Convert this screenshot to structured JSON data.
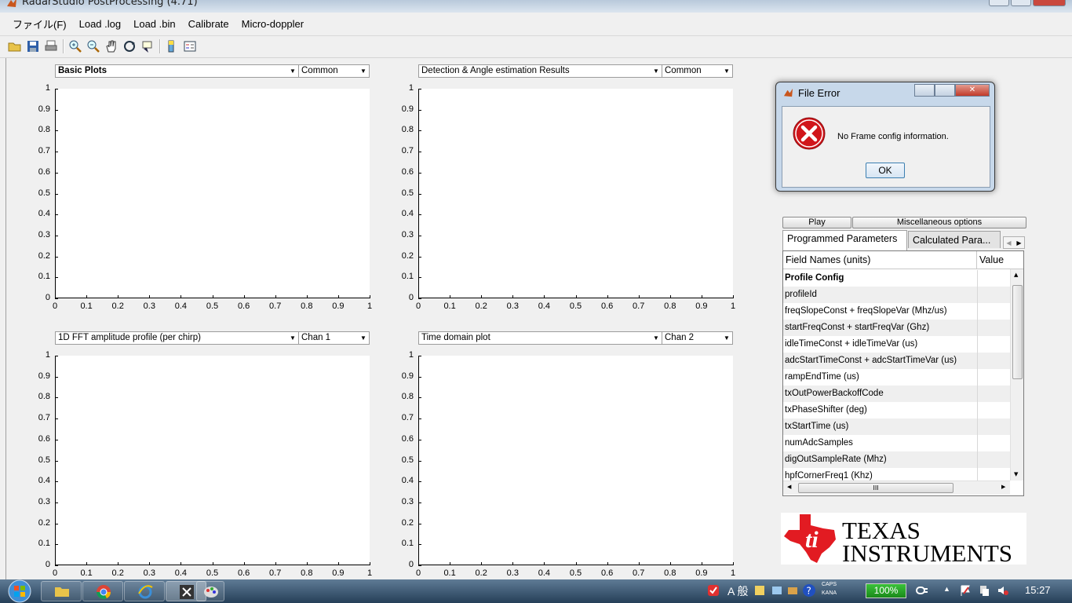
{
  "window": {
    "title": "RadarStudio PostProcessing (4.71)"
  },
  "menu": [
    "ファイル(F)",
    "Load .log",
    "Load .bin",
    "Calibrate",
    "Micro-doppler"
  ],
  "toolbar": {
    "icons": [
      "open-folder-icon",
      "save-icon",
      "print-icon",
      "zoom-in-icon",
      "zoom-out-icon",
      "pan-hand-icon",
      "rotate-3d-icon",
      "data-cursor-icon",
      "colorbar-icon",
      "legend-icon"
    ]
  },
  "plots": [
    {
      "select": "Basic Plots",
      "select_bold": true,
      "channel": "Common"
    },
    {
      "select": "Detection & Angle estimation Results",
      "select_bold": false,
      "channel": "Common"
    },
    {
      "select": "1D FFT amplitude profile (per chirp)",
      "select_bold": false,
      "channel": "Chan 1"
    },
    {
      "select": "Time domain plot",
      "select_bold": false,
      "channel": "Chan 2"
    }
  ],
  "axes": {
    "y_ticks": [
      "1",
      "0.9",
      "0.8",
      "0.7",
      "0.6",
      "0.5",
      "0.4",
      "0.3",
      "0.2",
      "0.1",
      "0"
    ],
    "x_ticks": [
      "0",
      "0.1",
      "0.2",
      "0.3",
      "0.4",
      "0.5",
      "0.6",
      "0.7",
      "0.8",
      "0.9",
      "1"
    ]
  },
  "dialog": {
    "title": "File Error",
    "message": "No Frame config information.",
    "ok_label": "OK"
  },
  "panel": {
    "play_label": "Play",
    "misc_label": "Miscellaneous options",
    "tabs": [
      "Programmed Parameters",
      "Calculated Para..."
    ],
    "table_headers": {
      "field": "Field Names    (units)",
      "value": "Value"
    },
    "rows": [
      "Profile Config",
      "profileId",
      "freqSlopeConst + freqSlopeVar (Mhz/us)",
      "startFreqConst + startFreqVar (Ghz)",
      "idleTimeConst + idleTimeVar (us)",
      "adcStartTimeConst + adcStartTimeVar (us)",
      "rampEndTime (us)",
      "txOutPowerBackoffCode",
      "txPhaseShifter (deg)",
      "txStartTime (us)",
      "numAdcSamples",
      "digOutSampleRate (Mhz)",
      "hpfCornerFreq1 (Khz)"
    ],
    "hscroll_grip": "III"
  },
  "logo": {
    "line1": "TEXAS",
    "line2": "INSTRUMENTS",
    "color": "#e21b22"
  },
  "taskbar": {
    "battery": "100%",
    "caps": "CAPS",
    "kana": "KANA",
    "ime": "A 般",
    "clock": "15:27"
  }
}
